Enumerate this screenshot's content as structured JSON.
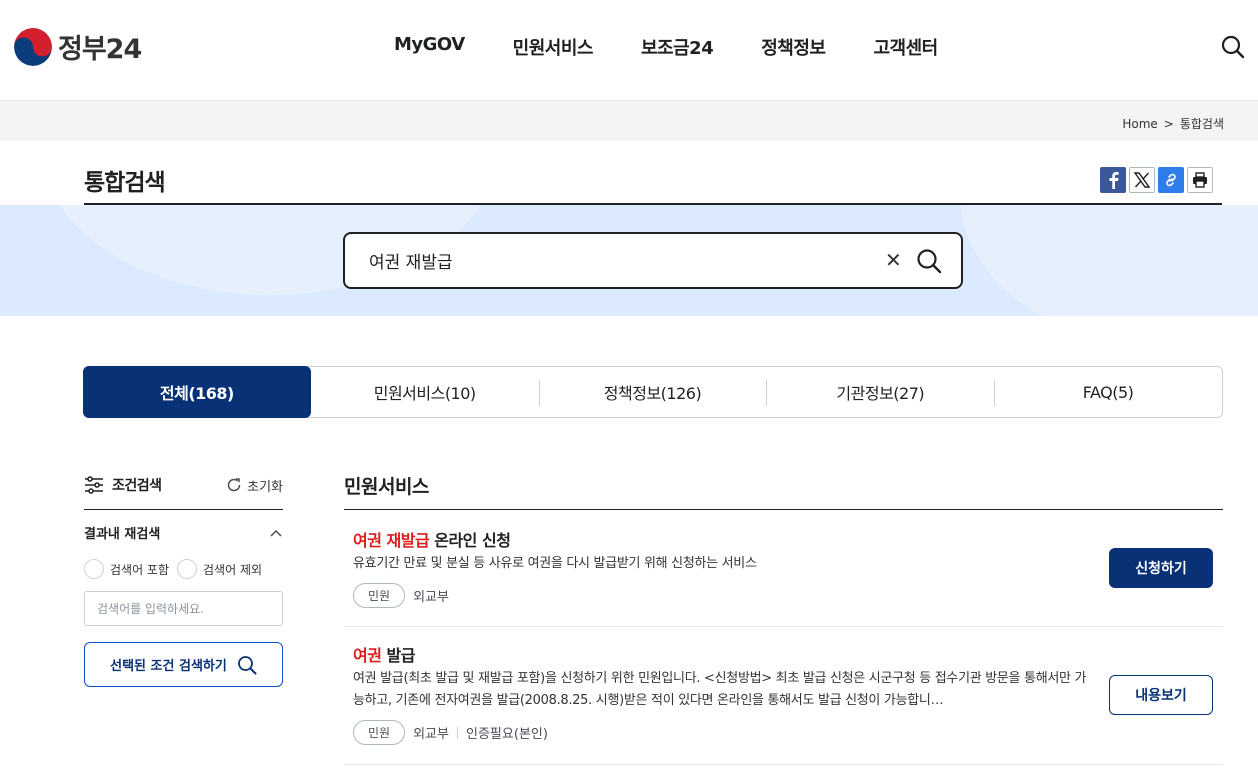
{
  "header": {
    "logo_text": "정부24",
    "nav": [
      "MyGOV",
      "민원서비스",
      "보조금24",
      "정책정보",
      "고객센터"
    ]
  },
  "breadcrumb": {
    "home": "Home",
    "separator": ">",
    "current": "통합검색"
  },
  "page_title": "통합검색",
  "search": {
    "query": "여권 재발급"
  },
  "tabs": [
    {
      "label": "전체(168)",
      "active": true
    },
    {
      "label": "민원서비스(10)",
      "active": false
    },
    {
      "label": "정책정보(126)",
      "active": false
    },
    {
      "label": "기관정보(27)",
      "active": false
    },
    {
      "label": "FAQ(5)",
      "active": false
    }
  ],
  "filter": {
    "title": "조건검색",
    "reset_label": "초기화",
    "refine_title": "결과내 재검색",
    "include_label": "검색어 포함",
    "exclude_label": "검색어 제외",
    "input_placeholder": "검색어를 입력하세요.",
    "submit_label": "선택된 조건 검색하기"
  },
  "results_section": {
    "title": "민원서비스",
    "items": [
      {
        "title_highlight": "여권 재발급",
        "title_rest": " 온라인 신청",
        "description": "유효기간 만료 및 분실 등 사유로 여권을 다시 발급받기 위해 신청하는 서비스",
        "tag": "민원",
        "agency": "외교부",
        "button": "신청하기"
      },
      {
        "title_highlight": "여권",
        "title_rest": " 발급",
        "description": "여권 발급(최초 발급 및 재발급 포함)을 신청하기 위한 민원입니다. <신청방법> 최초 발급 신청은 시군구청 등 접수기관 방문을 통해서만 가능하고, 기존에 전자여권을 발급(2008.8.25. 시행)받은 적이 있다면 온라인을 통해서도 발급 신청이 가능합니…",
        "tag": "민원",
        "agency": "외교부",
        "extra": "인증필요(본인)",
        "button": "내용보기"
      }
    ]
  },
  "colors": {
    "primary": "#083176",
    "highlight": "#de1d1d",
    "band": "#dbeafe"
  }
}
